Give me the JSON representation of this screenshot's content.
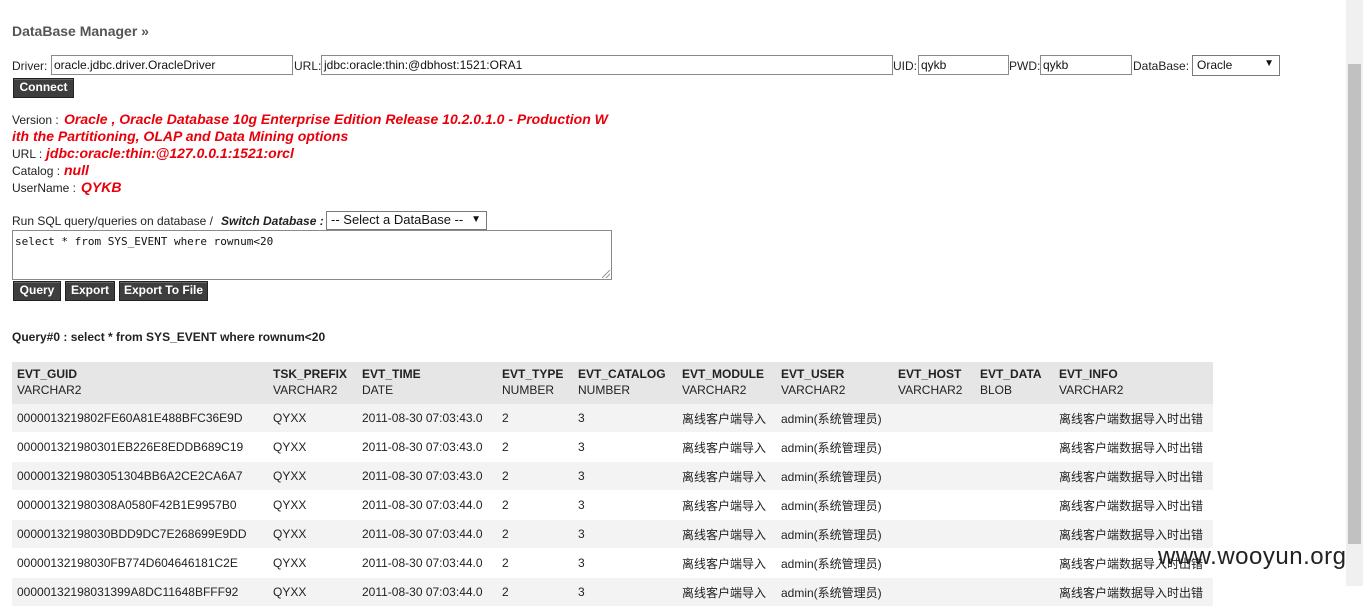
{
  "app": {
    "title": "DataBase Manager »"
  },
  "connection": {
    "driver_label": "Driver:",
    "driver_value": "oracle.jdbc.driver.OracleDriver",
    "url_label": "URL:",
    "url_value": "jdbc:oracle:thin:@dbhost:1521:ORA1",
    "uid_label": "UID:",
    "uid_value": "qykb",
    "pwd_label": "PWD:",
    "pwd_value": "qykb",
    "database_label": "DataBase:",
    "database_selected": "Oracle",
    "connect_label": "Connect"
  },
  "info": {
    "version_label": "Version :",
    "version_line1": "Oracle , Oracle Database 10g Enterprise Edition Release 10.2.0.1.0 - Production W",
    "version_line2": "ith the Partitioning, OLAP and Data Mining options",
    "url_label": "URL :",
    "url_value": "jdbc:oracle:thin:@127.0.0.1:1521:orcl",
    "catalog_label": "Catalog :",
    "catalog_value": "null",
    "username_label": "UserName :",
    "username_value": "QYKB"
  },
  "query": {
    "run_label": "Run SQL query/queries on database / ",
    "switch_label": "Switch Database :",
    "switch_selected": "-- Select a DataBase --",
    "sql_text": "select * from SYS_EVENT where rownum<20",
    "query_button": "Query",
    "export_button": "Export",
    "export_file_button": "Export To File",
    "result_title": "Query#0 : select * from SYS_EVENT where rownum<20"
  },
  "table": {
    "columns": [
      {
        "name": "EVT_GUID",
        "type": "VARCHAR2"
      },
      {
        "name": "TSK_PREFIX",
        "type": "VARCHAR2"
      },
      {
        "name": "EVT_TIME",
        "type": "DATE"
      },
      {
        "name": "EVT_TYPE",
        "type": "NUMBER"
      },
      {
        "name": "EVT_CATALOG",
        "type": "NUMBER"
      },
      {
        "name": "EVT_MODULE",
        "type": "VARCHAR2"
      },
      {
        "name": "EVT_USER",
        "type": "VARCHAR2"
      },
      {
        "name": "EVT_HOST",
        "type": "VARCHAR2"
      },
      {
        "name": "EVT_DATA",
        "type": "BLOB"
      },
      {
        "name": "EVT_INFO",
        "type": "VARCHAR2"
      }
    ],
    "rows": [
      [
        "0000013219802FE60A81E488BFC36E9D",
        "QYXX",
        "2011-08-30 07:03:43.0",
        "2",
        "3",
        "离线客户端导入",
        "admin(系统管理员)",
        "",
        "",
        "离线客户端数据导入时出错"
      ],
      [
        "000001321980301EB226E8EDDB689C19",
        "QYXX",
        "2011-08-30 07:03:43.0",
        "2",
        "3",
        "离线客户端导入",
        "admin(系统管理员)",
        "",
        "",
        "离线客户端数据导入时出错"
      ],
      [
        "0000013219803051304BB6A2CE2CA6A7",
        "QYXX",
        "2011-08-30 07:03:43.0",
        "2",
        "3",
        "离线客户端导入",
        "admin(系统管理员)",
        "",
        "",
        "离线客户端数据导入时出错"
      ],
      [
        "000001321980308A0580F42B1E9957B0",
        "QYXX",
        "2011-08-30 07:03:44.0",
        "2",
        "3",
        "离线客户端导入",
        "admin(系统管理员)",
        "",
        "",
        "离线客户端数据导入时出错"
      ],
      [
        "00000132198030BDD9DC7E268699E9DD",
        "QYXX",
        "2011-08-30 07:03:44.0",
        "2",
        "3",
        "离线客户端导入",
        "admin(系统管理员)",
        "",
        "",
        "离线客户端数据导入时出错"
      ],
      [
        "00000132198030FB774D604646181C2E",
        "QYXX",
        "2011-08-30 07:03:44.0",
        "2",
        "3",
        "离线客户端导入",
        "admin(系统管理员)",
        "",
        "",
        "离线客户端数据导入时出错"
      ],
      [
        "00000132198031399A8DC11648BFFF92",
        "QYXX",
        "2011-08-30 07:03:44.0",
        "2",
        "3",
        "离线客户端导入",
        "admin(系统管理员)",
        "",
        "",
        "离线客户端数据导入时出错"
      ]
    ]
  },
  "watermark": "www.wooyun.org"
}
